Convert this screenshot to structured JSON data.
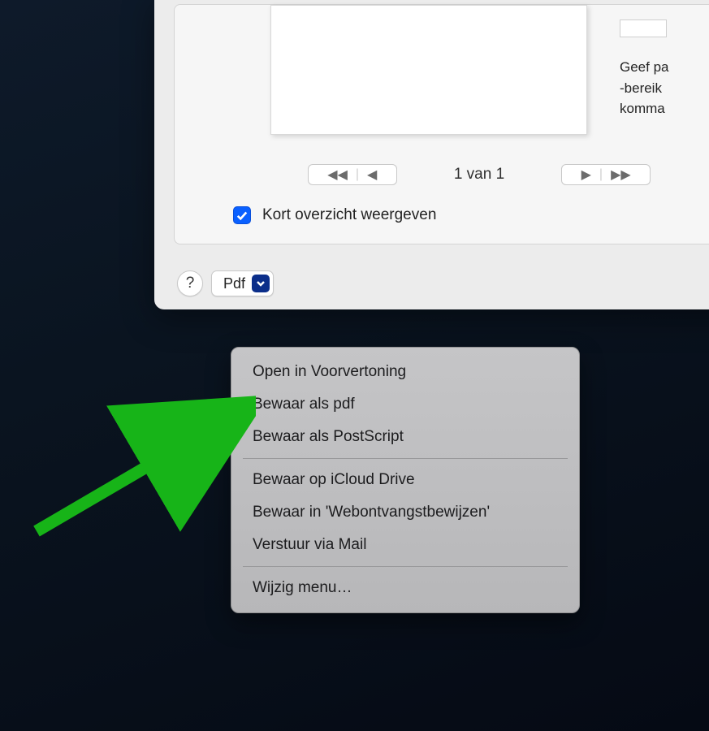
{
  "preview": {
    "page_indicator": "1 van 1",
    "checkbox_label": "Kort overzicht weergeven",
    "checkbox_checked": true,
    "right_text": "Geef pa\n-bereik\nkomma"
  },
  "bottom": {
    "help_label": "?",
    "pdf_label": "Pdf"
  },
  "menu": {
    "items": [
      "Open in Voorvertoning",
      "Bewaar als pdf",
      "Bewaar als PostScript"
    ],
    "items2": [
      "Bewaar op iCloud Drive",
      "Bewaar in 'Webontvangstbewijzen'",
      "Verstuur via Mail"
    ],
    "items3": [
      "Wijzig menu…"
    ]
  }
}
